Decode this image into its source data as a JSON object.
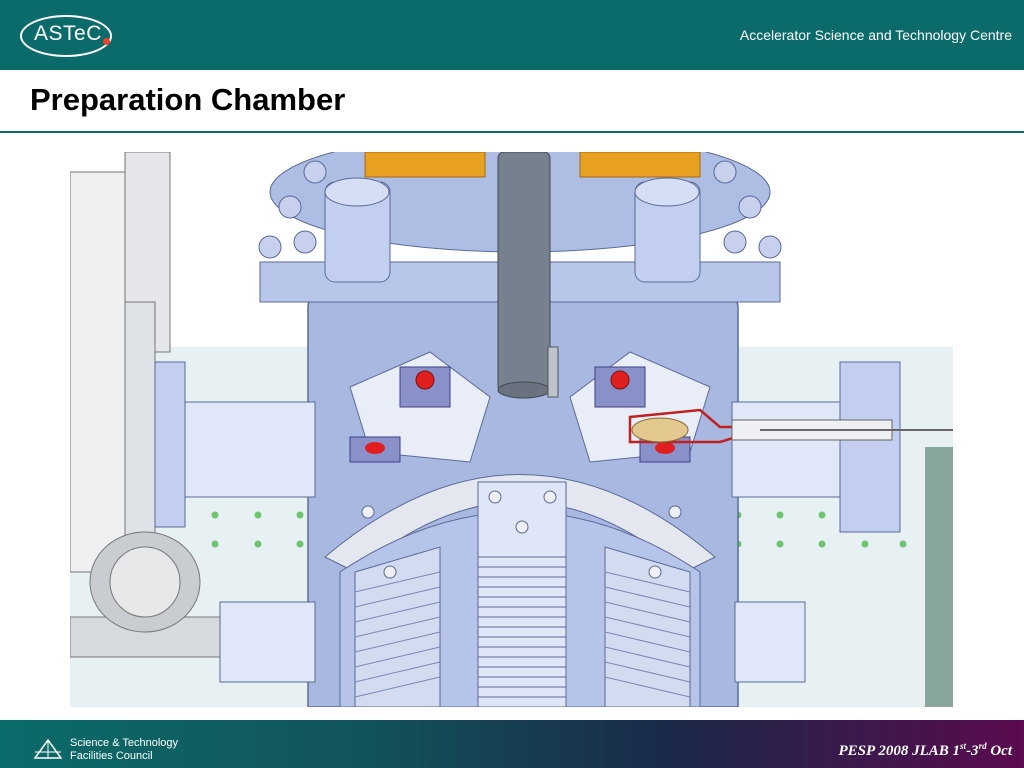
{
  "header": {
    "logo_text": "ASTeC",
    "organization": "Accelerator Science and Technology Centre"
  },
  "slide": {
    "title": "Preparation Chamber"
  },
  "footer": {
    "stfc_line1": "Science & Technology",
    "stfc_line2": "Facilities Council",
    "event": "PESP 2008 JLAB 1",
    "sup1": "st",
    "dash": "-3",
    "sup2": "rd",
    "month": " Oct"
  },
  "colors": {
    "header_bg": "#0b6b6a",
    "chamber_blue": "#a8b8e0",
    "flange_orange": "#e8a020",
    "sample_red": "#e02020"
  }
}
